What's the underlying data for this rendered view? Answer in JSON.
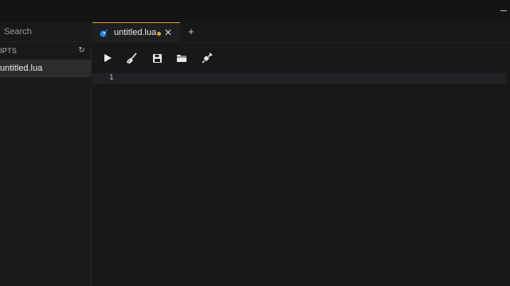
{
  "sidebar": {
    "search_placeholder": "Search",
    "section_title": "IPTS",
    "refresh_glyph": "↻",
    "files": [
      {
        "label": "untitled.lua"
      }
    ]
  },
  "tabs": [
    {
      "label": "untitled.lua",
      "icon": "lua-icon",
      "modified": true,
      "close_glyph": "✕"
    }
  ],
  "add_tab_glyph": "+",
  "toolbar": {
    "buttons": [
      {
        "name": "run",
        "icon": "play-icon"
      },
      {
        "name": "clear",
        "icon": "broom-icon"
      },
      {
        "name": "save",
        "icon": "save-icon"
      },
      {
        "name": "open",
        "icon": "folder-icon"
      },
      {
        "name": "inject",
        "icon": "syringe-icon"
      }
    ]
  },
  "editor": {
    "line_numbers": [
      "1"
    ]
  },
  "colors": {
    "accent": "#e0a526",
    "modified_dot": "#e3a03a",
    "lua_blue": "#1e88e5"
  }
}
